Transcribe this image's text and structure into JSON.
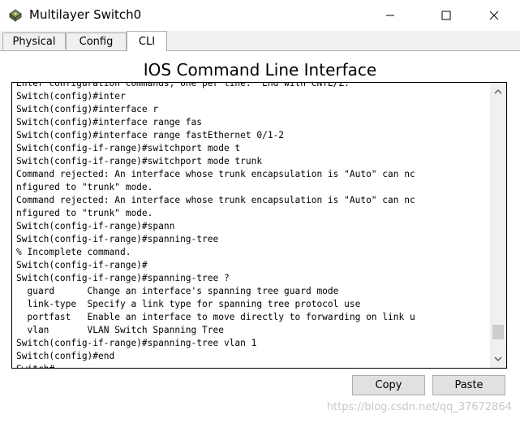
{
  "window": {
    "title": "Multilayer Switch0",
    "controls": {
      "minimize": "─",
      "maximize": "☐",
      "close": "✕"
    }
  },
  "tabs": [
    {
      "label": "Physical",
      "active": false
    },
    {
      "label": "Config",
      "active": false
    },
    {
      "label": "CLI",
      "active": true
    }
  ],
  "cli": {
    "heading": "IOS Command Line Interface",
    "lines": [
      "Enter configuration commands, one per line.  End with CNTL/Z.",
      "Switch(config)#inter",
      "Switch(config)#interface r",
      "Switch(config)#interface range fas",
      "Switch(config)#interface range fastEthernet 0/1-2",
      "Switch(config-if-range)#switchport mode t",
      "Switch(config-if-range)#switchport mode trunk",
      "Command rejected: An interface whose trunk encapsulation is \"Auto\" can nc",
      "nfigured to \"trunk\" mode.",
      "Command rejected: An interface whose trunk encapsulation is \"Auto\" can nc",
      "nfigured to \"trunk\" mode.",
      "Switch(config-if-range)#spann",
      "Switch(config-if-range)#spanning-tree",
      "% Incomplete command.",
      "Switch(config-if-range)#",
      "Switch(config-if-range)#spanning-tree ?",
      "  guard      Change an interface's spanning tree guard mode",
      "  link-type  Specify a link type for spanning tree protocol use",
      "  portfast   Enable an interface to move directly to forwarding on link u",
      "  vlan       VLAN Switch Spanning Tree",
      "Switch(config-if-range)#spanning-tree vlan 1",
      "Switch(config)#end",
      "Switch#"
    ]
  },
  "buttons": {
    "copy": "Copy",
    "paste": "Paste"
  },
  "watermark": "https://blog.csdn.net/qq_37672864",
  "colors": {
    "accent_border": "#adadad",
    "terminal_border": "#000000"
  }
}
